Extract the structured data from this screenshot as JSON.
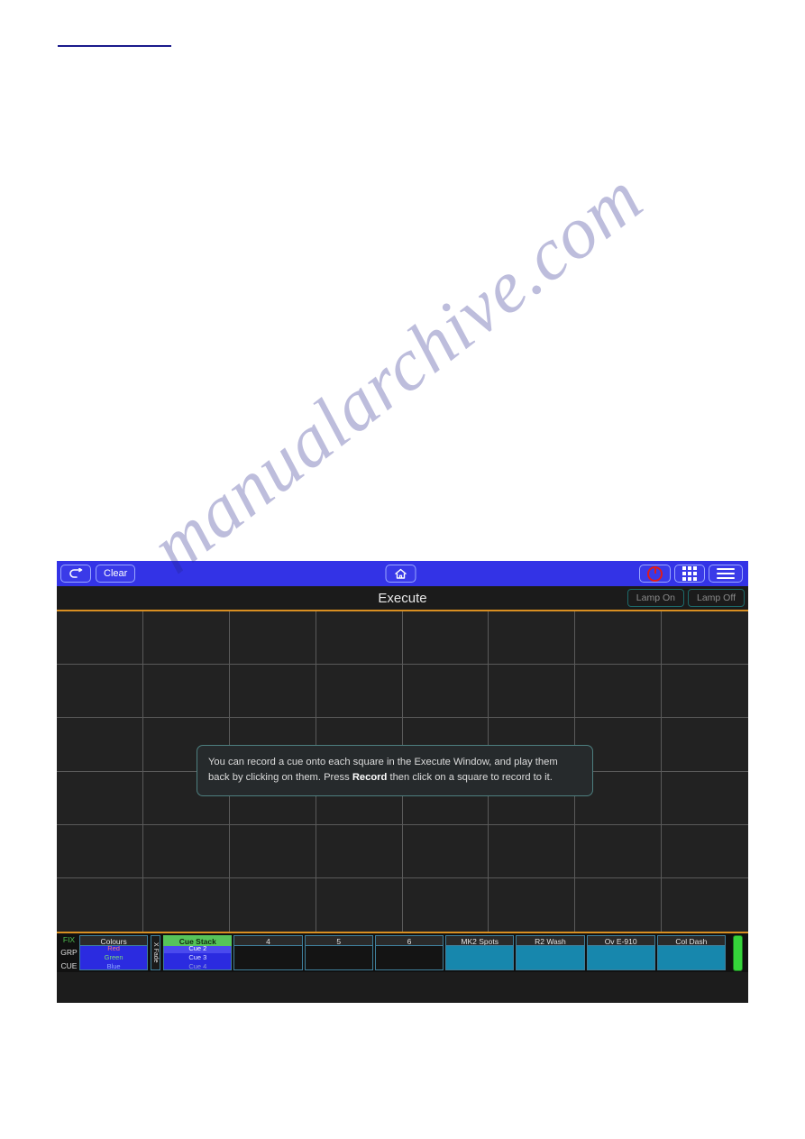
{
  "page": {
    "top_link_text": "",
    "watermark": "manualarchive.com"
  },
  "device": {
    "toolbar": {
      "back_icon": "back-arrow-icon",
      "clear_label": "Clear",
      "home_icon": "home-icon",
      "power_icon": "power-icon",
      "grid_icon": "grid-apps-icon",
      "menu_icon": "hamburger-menu-icon"
    },
    "titlebar": {
      "title": "Execute",
      "lamp_on_label": "Lamp On",
      "lamp_off_label": "Lamp Off"
    },
    "tooltip": {
      "text_part1": "You can record a cue onto each square in the Execute Window, and play them back by clicking on them. Press ",
      "bold_word": "Record",
      "text_part2": " then click on a square to record to it."
    },
    "exec_grid": {
      "columns": 8,
      "rows": 6
    },
    "bottom_bar": {
      "side_labels": [
        "FIX",
        "GRP",
        "CUE"
      ],
      "xfade_label": "X Fade",
      "playbacks": [
        {
          "header": "Colours",
          "header_style": "dark",
          "body_style": "blue",
          "lines": [
            {
              "text": "Red",
              "class": "l-red"
            },
            {
              "text": "Green",
              "class": "l-green"
            },
            {
              "text": "Blue",
              "class": "l-blue"
            }
          ]
        },
        {
          "header": "Cue Stack",
          "header_style": "green",
          "body_style": "blue",
          "cues": [
            {
              "text": "Cue 2",
              "selected": true
            },
            {
              "text": "Cue 3",
              "selected": false
            },
            {
              "text": "Cue 4",
              "selected": false,
              "dim": true
            }
          ]
        },
        {
          "header": "4",
          "header_style": "dark",
          "body_style": "dark"
        },
        {
          "header": "5",
          "header_style": "dark",
          "body_style": "dark"
        },
        {
          "header": "6",
          "header_style": "dark",
          "body_style": "dark"
        },
        {
          "header": "MK2 Spots",
          "header_style": "dark",
          "body_style": "teal"
        },
        {
          "header": "R2 Wash",
          "header_style": "dark",
          "body_style": "teal"
        },
        {
          "header": "Ov E-910",
          "header_style": "dark",
          "body_style": "teal"
        },
        {
          "header": "Col Dash",
          "header_style": "dark",
          "body_style": "teal"
        }
      ],
      "master_fader": {
        "name": "grand-master-fader",
        "color": "#35d43a"
      }
    }
  }
}
